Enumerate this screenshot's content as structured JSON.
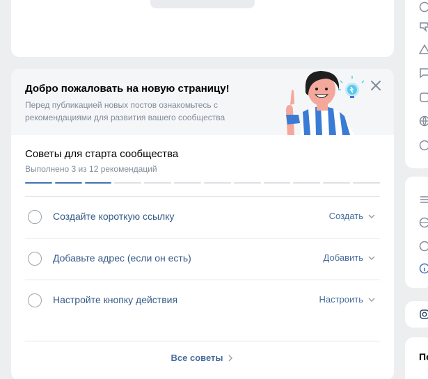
{
  "banner": {
    "title": "Добро пожаловать на новую страницу!",
    "description": "Перед публикацией новых постов ознакомьтесь с рекомендациями для развития вашего сообщества",
    "illustration": "waving-person-illustration",
    "close_icon": "close-icon"
  },
  "progress": {
    "title": "Советы для старта сообщества",
    "subtitle": "Выполнено 3 из 12 рекомендаций",
    "completed": 3,
    "total": 12
  },
  "tasks": [
    {
      "label": "Создайте короткую ссылку",
      "action": "Создать"
    },
    {
      "label": "Добавьте адрес (если он есть)",
      "action": "Добавить"
    },
    {
      "label": "Настройте кнопку действия",
      "action": "Настроить"
    }
  ],
  "all_tips": {
    "label": "Все советы"
  },
  "right_column": {
    "partial_label": "По"
  },
  "colors": {
    "accent": "#3f74b4",
    "link": "#476d9b",
    "muted": "#818c99",
    "background": "#edeef0"
  }
}
